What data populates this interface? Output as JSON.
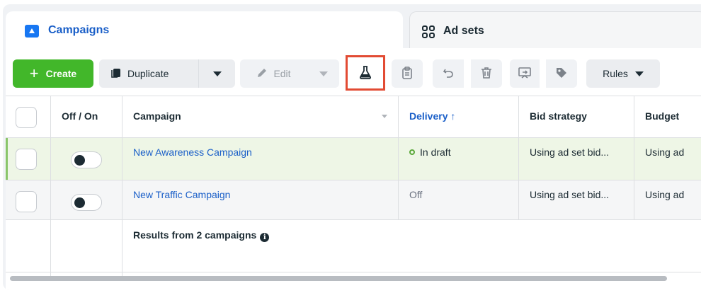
{
  "tabs": {
    "campaigns": "Campaigns",
    "ad_sets": "Ad sets"
  },
  "toolbar": {
    "create": "Create",
    "duplicate": "Duplicate",
    "edit": "Edit",
    "rules": "Rules"
  },
  "table": {
    "headers": {
      "off_on": "Off / On",
      "campaign": "Campaign",
      "delivery": "Delivery ↑",
      "bid_strategy": "Bid strategy",
      "budget": "Budget"
    },
    "rows": [
      {
        "campaign": "New Awareness Campaign",
        "delivery": "In draft",
        "bid_strategy": "Using ad set bid...",
        "budget": "Using ad"
      },
      {
        "campaign": "New Traffic Campaign",
        "delivery": "Off",
        "bid_strategy": "Using ad set bid...",
        "budget": "Using ad"
      }
    ],
    "results": "Results from 2 campaigns"
  },
  "colors": {
    "accent_blue": "#1a5fc8",
    "create_green": "#42b72a",
    "highlight_red": "#e24b33",
    "draft_dot": "#5aa83a"
  },
  "icons": [
    "campaigns-folder-icon",
    "ad-sets-grid-icon",
    "plus-icon",
    "duplicate-icon",
    "pencil-icon",
    "flask-icon",
    "clipboard-icon",
    "undo-icon",
    "trash-icon",
    "export-icon",
    "tag-icon",
    "info-icon"
  ]
}
